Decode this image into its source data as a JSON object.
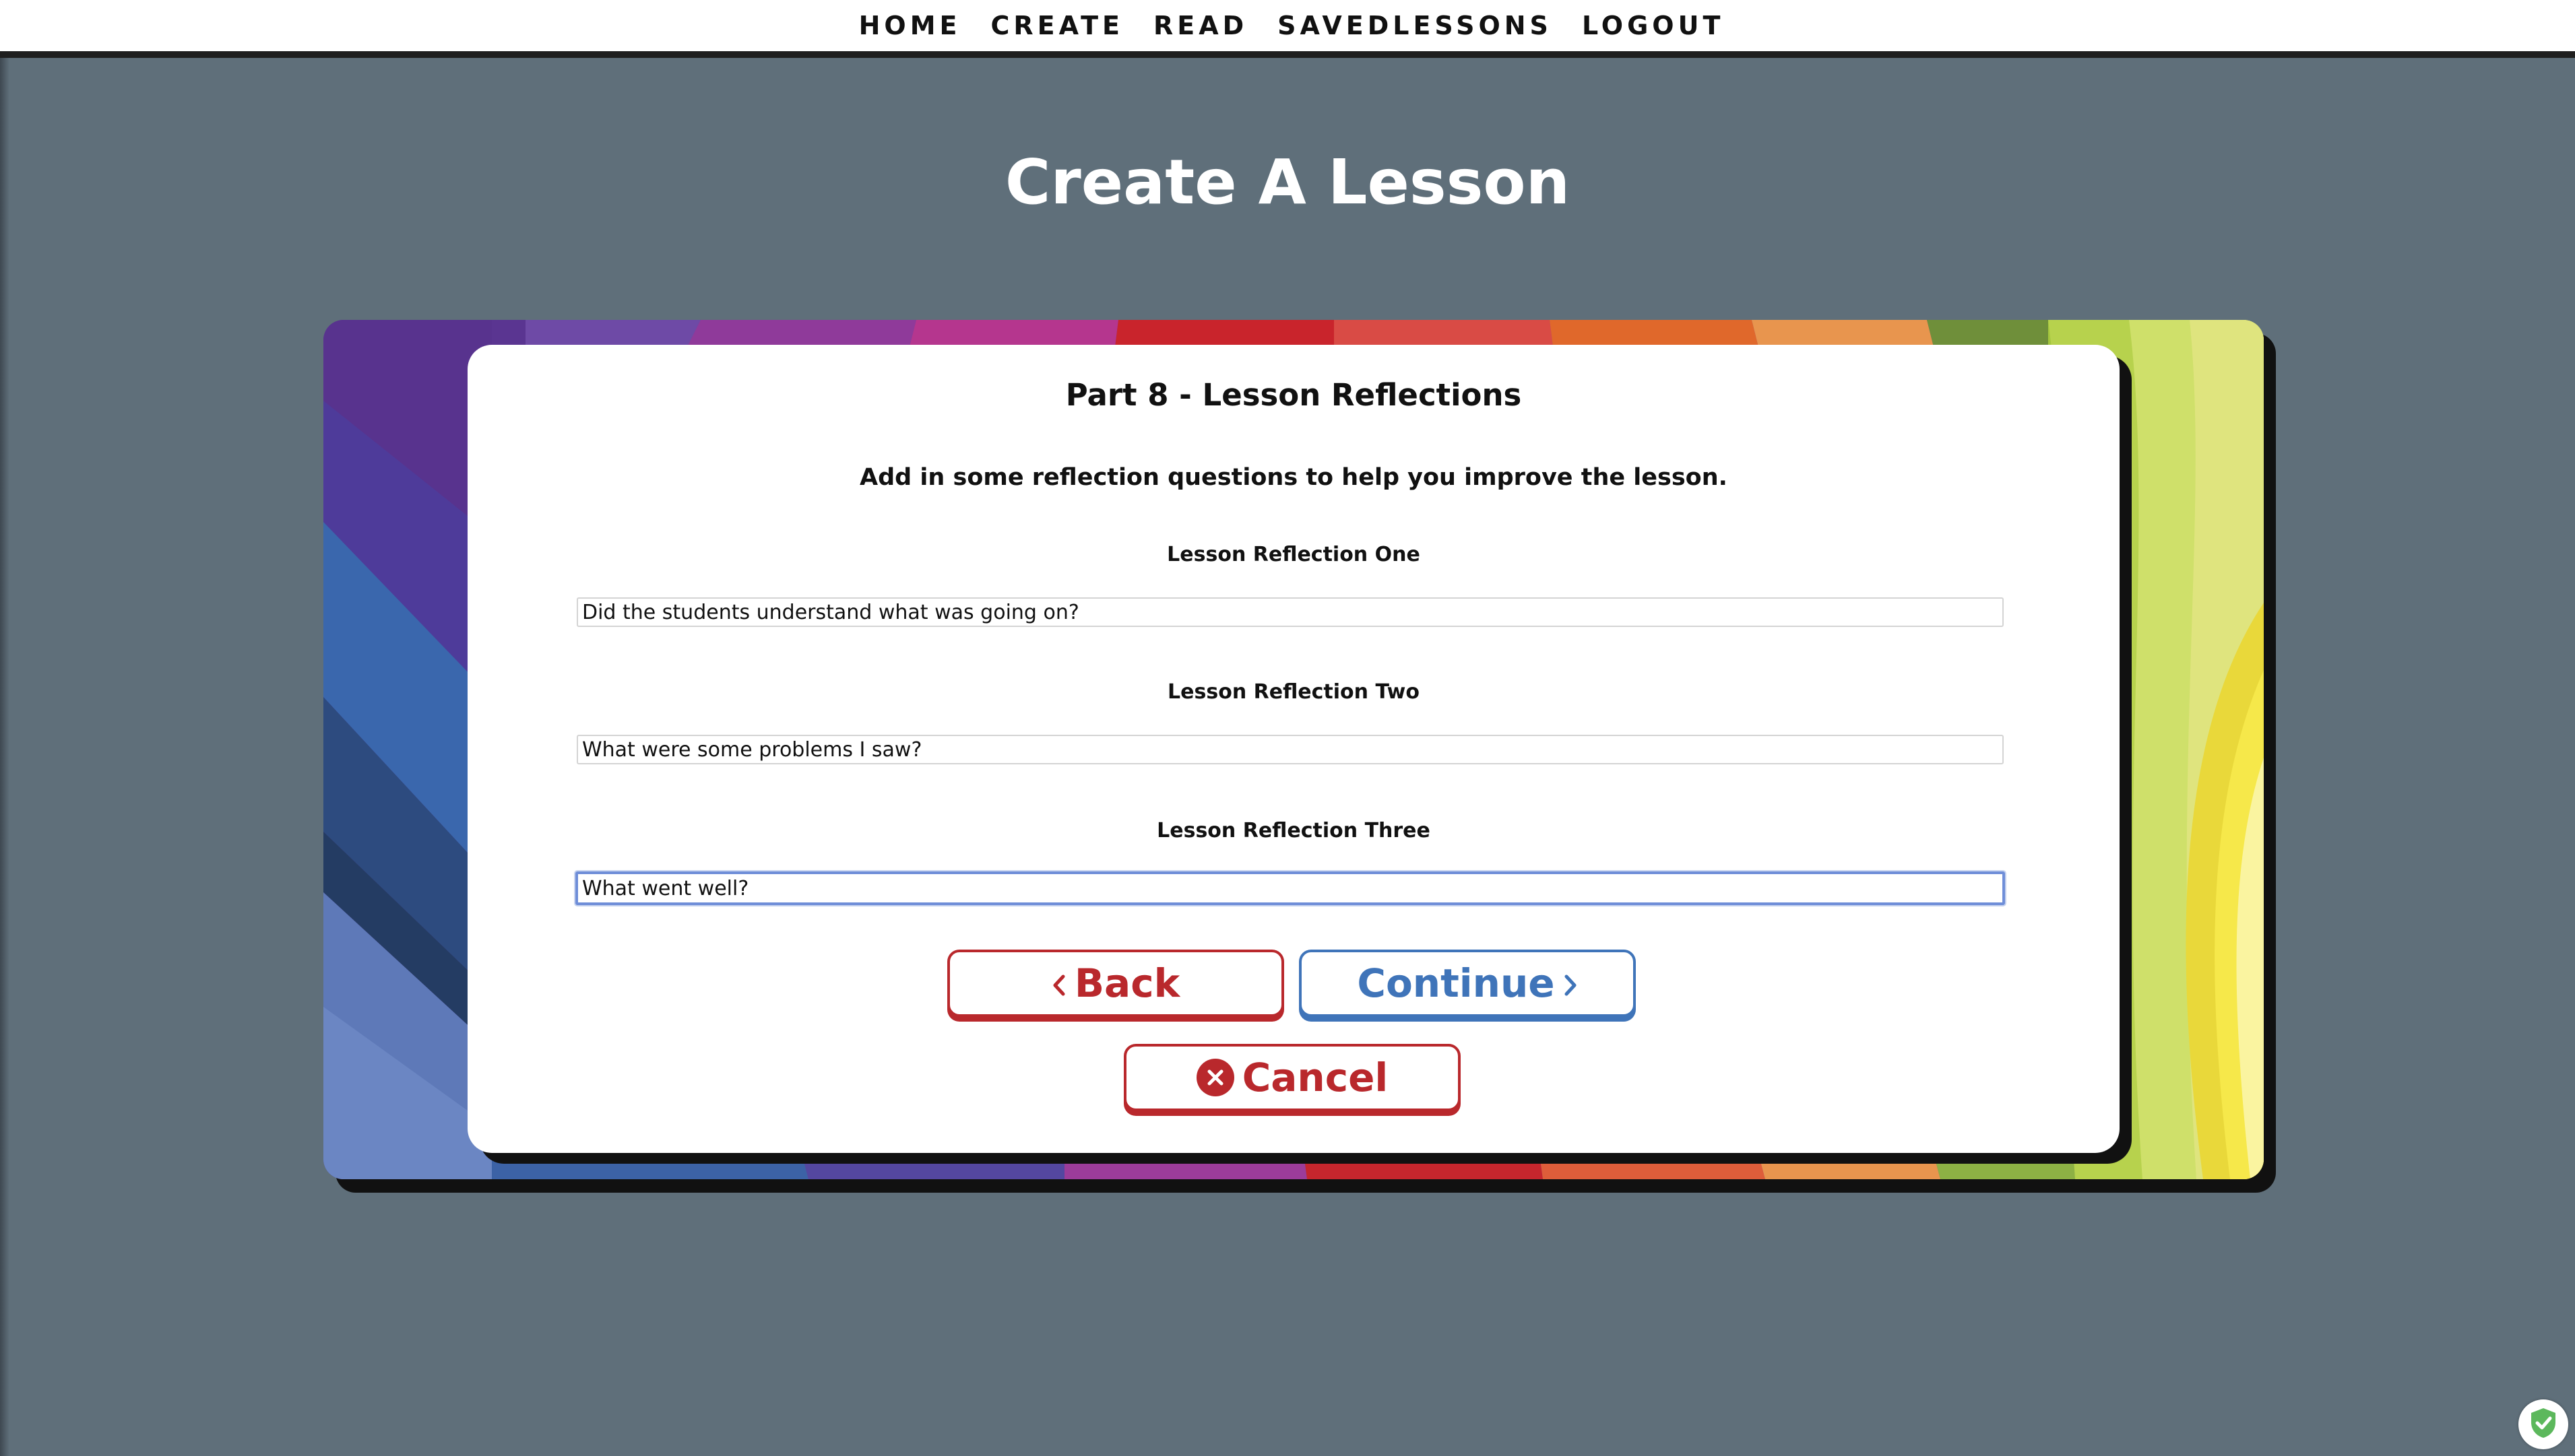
{
  "nav": {
    "items": [
      {
        "label": "HOME"
      },
      {
        "label": "CREATE"
      },
      {
        "label": "READ"
      },
      {
        "label": "SAVEDLESSONS"
      },
      {
        "label": "LOGOUT"
      }
    ]
  },
  "page": {
    "title": "Create A Lesson"
  },
  "form": {
    "part_title": "Part 8 - Lesson Reflections",
    "instructions": "Add in some reflection questions to help you improve the lesson.",
    "fields": [
      {
        "label": "Lesson Reflection One",
        "value": "Did the students understand what was going on?"
      },
      {
        "label": "Lesson Reflection Two",
        "value": "What were some problems I saw?"
      },
      {
        "label": "Lesson Reflection Three",
        "value": "What went well?"
      }
    ]
  },
  "buttons": {
    "back": "Back",
    "continue": "Continue",
    "cancel": "Cancel"
  },
  "colors": {
    "background": "#5f6f7a",
    "danger": "#b9282c",
    "primary": "#3f74b9",
    "focus": "#6f8ed8"
  },
  "icons": {
    "back": "chevron-left-icon",
    "continue": "chevron-right-icon",
    "cancel": "close-circle-icon",
    "badge": "shield-check-icon"
  }
}
